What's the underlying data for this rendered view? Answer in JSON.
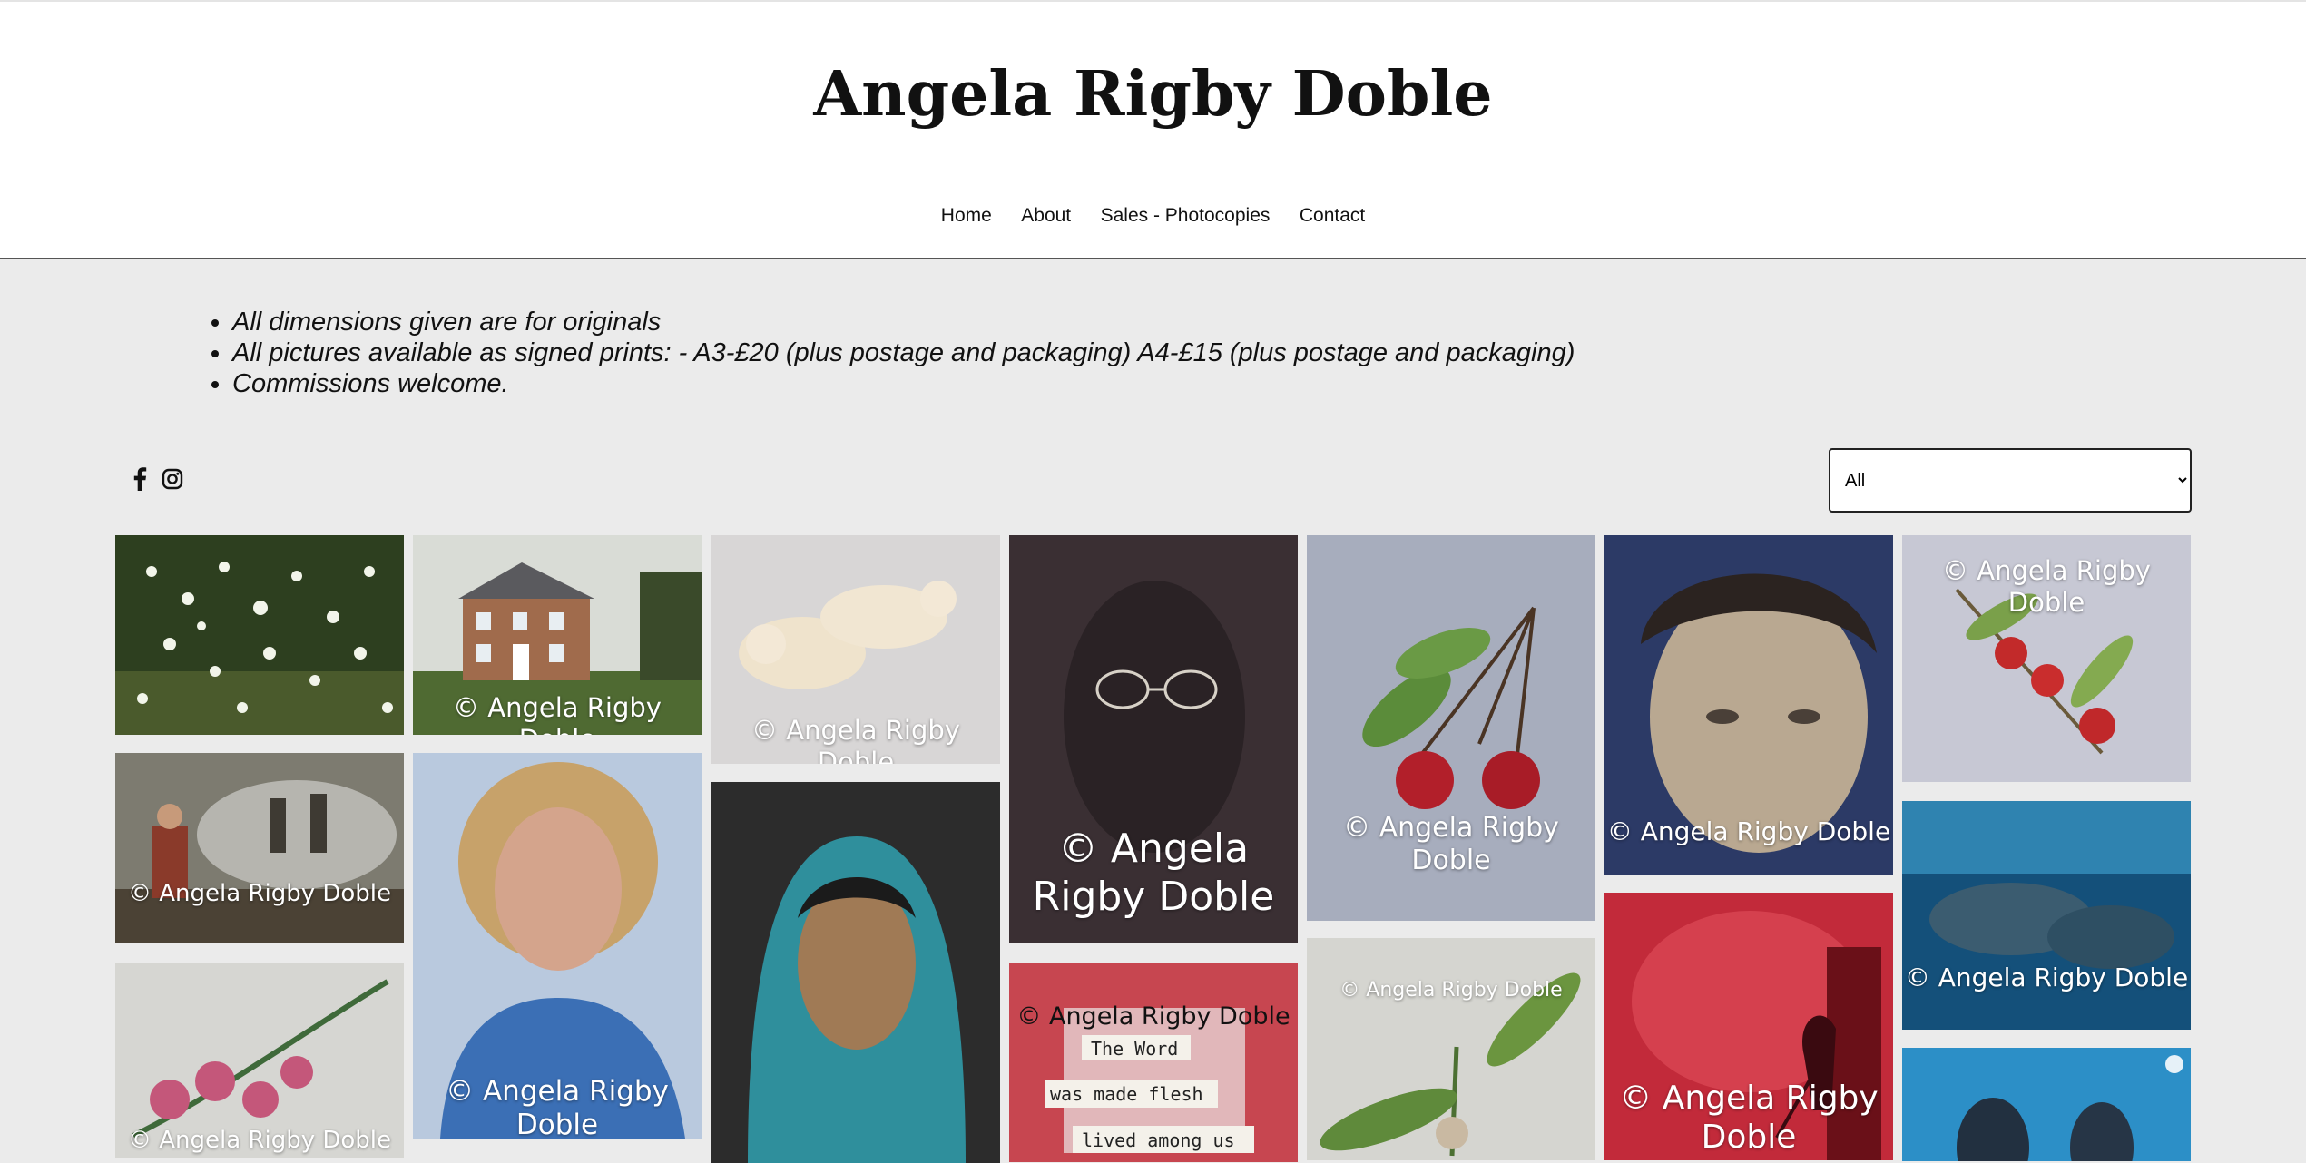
{
  "site": {
    "title": "Angela Rigby Doble"
  },
  "nav": {
    "items": [
      "Home",
      "About",
      "Sales - Photocopies",
      "Contact"
    ]
  },
  "notes": [
    "All dimensions given are for originals",
    "All pictures available as signed prints: - A3-£20 (plus postage and packaging) A4-£15 (plus postage and packaging)",
    "Commissions welcome."
  ],
  "social": {
    "icons": [
      "facebook-icon",
      "instagram-icon"
    ]
  },
  "filter": {
    "selected": "All"
  },
  "gallery": {
    "watermark": "© Angela Rigby Doble",
    "tiles": [
      {
        "subject": "blossom tree",
        "watermark": ""
      },
      {
        "subject": "country house",
        "watermark": "© Angela Rigby Doble"
      },
      {
        "subject": "polar bears",
        "watermark": "© Angela Rigby Doble"
      },
      {
        "subject": "portrait with glasses",
        "watermark": "© Angela Rigby Doble"
      },
      {
        "subject": "cherries",
        "watermark": "© Angela Rigby Doble"
      },
      {
        "subject": "boy portrait",
        "watermark": "© Angela Rigby Doble"
      },
      {
        "subject": "apples on branch",
        "watermark": "© Angela Rigby Doble"
      },
      {
        "subject": "bonfire figures",
        "watermark": "© Angela Rigby Doble"
      },
      {
        "subject": "woman portrait",
        "watermark": "© Angela Rigby Doble"
      },
      {
        "subject": "woman in blue headscarf",
        "watermark": ""
      },
      {
        "subject": "the word was made flesh",
        "watermark": "© Angela Rigby Doble",
        "lines": [
          "The Word",
          "was made flesh",
          "lived among us"
        ]
      },
      {
        "subject": "plant with roots",
        "watermark": "© Angela Rigby Doble"
      },
      {
        "subject": "red figure sweeping",
        "watermark": "© Angela Rigby Doble"
      },
      {
        "subject": "manatees",
        "watermark": "© Angela Rigby Doble"
      },
      {
        "subject": "carnations",
        "watermark": "© Angela Rigby Doble"
      },
      {
        "subject": "sea lions",
        "watermark": ""
      }
    ]
  }
}
